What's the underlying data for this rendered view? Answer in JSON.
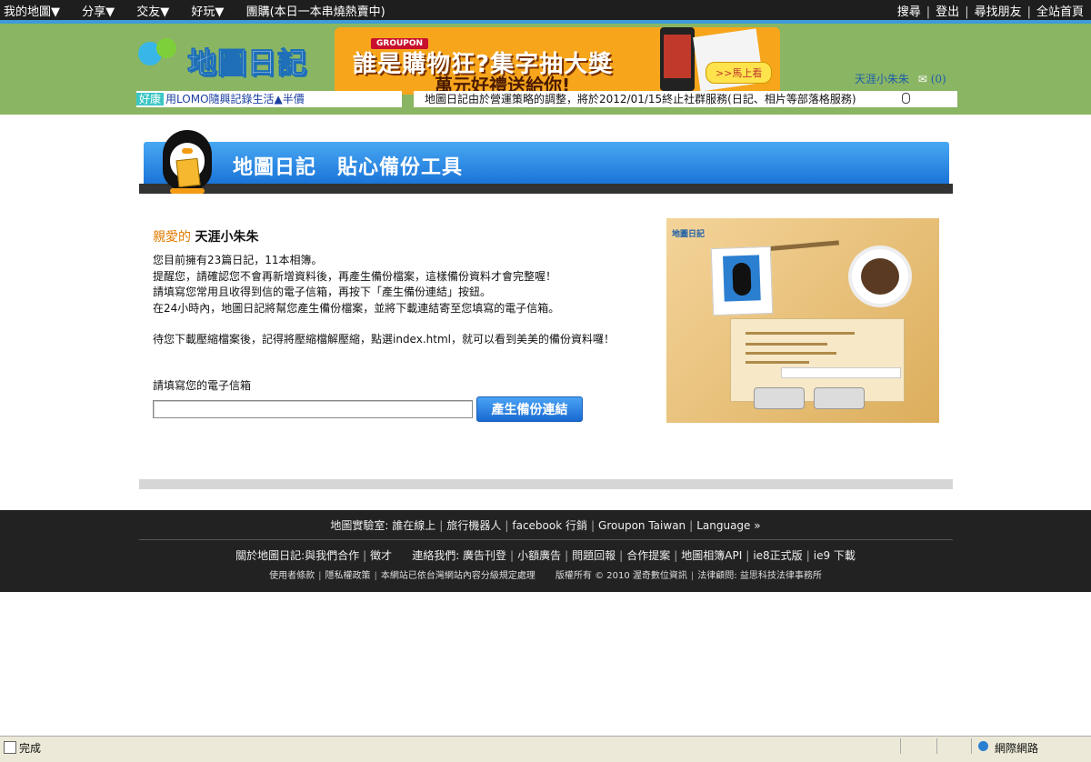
{
  "topnav": {
    "left": [
      "我的地圖▼",
      "分享▼",
      "交友▼",
      "好玩▼",
      "團購(本日一本串燒熱賣中)"
    ],
    "right": [
      "搜尋",
      "登出",
      "尋找朋友",
      "全站首頁"
    ]
  },
  "header": {
    "logo_text": "地圖日記",
    "banner": {
      "brand": "GROUPON",
      "headline": "誰是購物狂?集字抽大獎",
      "subline": "萬元好禮送給你!",
      "cta": ">>馬上看"
    },
    "user": {
      "name": "天涯小朱朱",
      "mail_count": "(0)"
    },
    "ticker_left": {
      "tag": "好康",
      "text": "用LOMO隨興記錄生活▲半價"
    },
    "ticker_right": "地圖日記由於營運策略的調整，將於2012/01/15終止社群服務(日記、相片等部落格服務)"
  },
  "page_title": "地圖日記　貼心備份工具",
  "greeting": {
    "dear": "親愛的",
    "name": "天涯小朱朱"
  },
  "info_lines": [
    "您目前擁有23篇日記，11本相簿。",
    "提醒您，請確認您不會再新增資料後，再產生備份檔案，這樣備份資料才會完整喔！",
    "請填寫您常用且收得到信的電子信箱，再按下「產生備份連結」按鈕。",
    "在24小時內，地圖日記將幫您產生備份檔案，並將下載連結寄至您填寫的電子信箱。"
  ],
  "info_extra": "待您下載壓縮檔案後，記得將壓縮檔解壓縮，點選index.html，就可以看到美美的備份資料囉！",
  "email_label": "請填寫您的電子信箱",
  "email_value": "",
  "generate_button": "產生備份連結",
  "preview": {
    "logo": "地圖日記"
  },
  "footer": {
    "row1": [
      "地圖實驗室: 誰在線上",
      "旅行機器人",
      "facebook 行銷",
      "Groupon Taiwan",
      "Language »"
    ],
    "row2a": [
      "關於地圖日記:與我們合作",
      "徵才"
    ],
    "row2b": [
      "連絡我們: 廣告刊登",
      "小額廣告",
      "問題回報",
      "合作提案",
      "地圖相簿API",
      "ie8正式版",
      "ie9 下載"
    ],
    "row3a": [
      "使用者條款",
      "隱私權政策",
      "本網站已依台灣網站內容分級規定處理"
    ],
    "row3b": [
      "版權所有 © 2010 渥奇數位資訊",
      "法律顧問: 益思科技法律事務所"
    ]
  },
  "statusbar": {
    "status": "完成",
    "zone": "網際網路"
  }
}
